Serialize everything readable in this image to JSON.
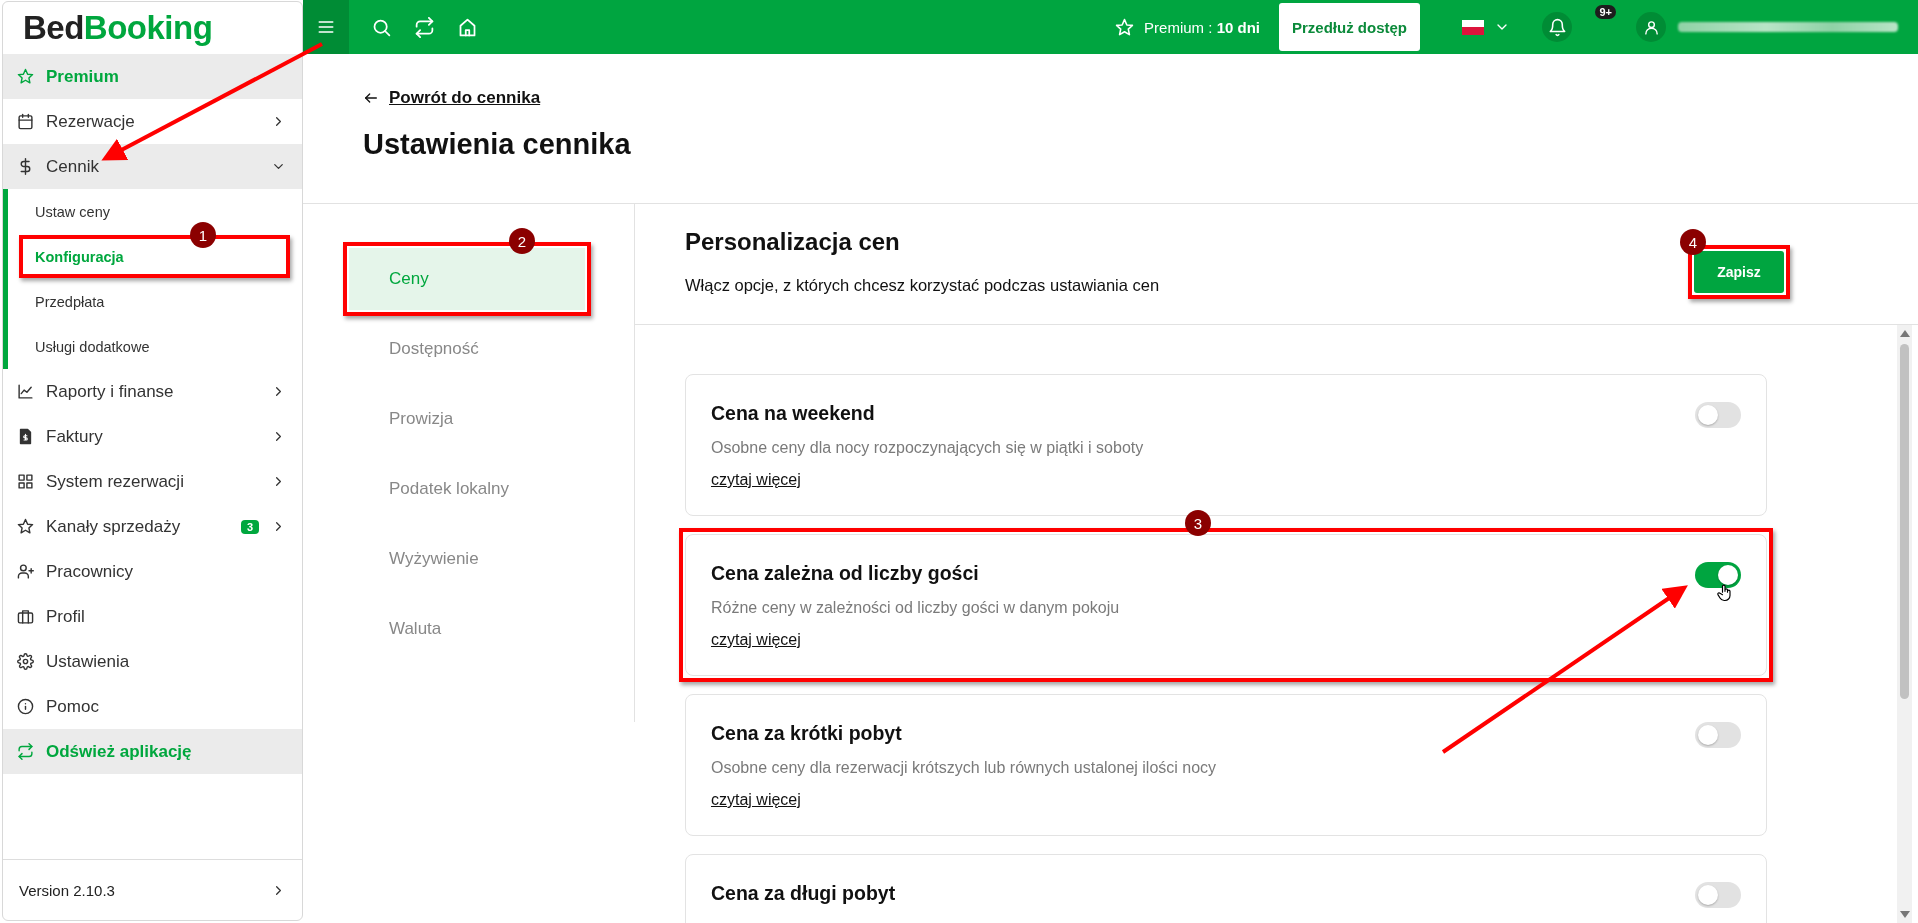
{
  "logo": {
    "part1": "Bed",
    "part2": "Booking"
  },
  "topbar": {
    "premium_label": "Premium :",
    "premium_days": "10 dni",
    "extend_button": "Przedłuż dostęp",
    "notification_badge": "9+"
  },
  "sidebar": {
    "items": [
      {
        "label": "Premium",
        "kind": "action"
      },
      {
        "label": "Rezerwacje",
        "kind": "link",
        "selected": false,
        "expanded": false
      },
      {
        "label": "Cennik",
        "kind": "link",
        "selected": true,
        "expanded": true,
        "children": [
          {
            "label": "Ustaw ceny",
            "selected": false
          },
          {
            "label": "Konfiguracja",
            "selected": true,
            "annotation": "1"
          },
          {
            "label": "Przedpłata",
            "selected": false
          },
          {
            "label": "Usługi dodatkowe",
            "selected": false
          }
        ]
      },
      {
        "label": "Raporty i finanse",
        "kind": "link",
        "selected": false,
        "expanded": false
      },
      {
        "label": "Faktury",
        "kind": "link",
        "selected": false,
        "expanded": false
      },
      {
        "label": "System rezerwacji",
        "kind": "link",
        "selected": false,
        "expanded": false
      },
      {
        "label": "Kanały sprzedaży",
        "kind": "link",
        "selected": false,
        "expanded": false,
        "badge": "3"
      },
      {
        "label": "Pracownicy",
        "kind": "link",
        "selected": false
      },
      {
        "label": "Profil",
        "kind": "link",
        "selected": false
      },
      {
        "label": "Ustawienia",
        "kind": "link",
        "selected": false
      },
      {
        "label": "Pomoc",
        "kind": "link",
        "selected": false
      },
      {
        "label": "Odśwież aplikację",
        "kind": "action"
      }
    ],
    "version": "Version 2.10.3"
  },
  "page": {
    "back_link": "Powrót do cennika",
    "title": "Ustawienia cennika"
  },
  "tabs": [
    {
      "label": "Ceny",
      "selected": true,
      "annotation": "2"
    },
    {
      "label": "Dostępność",
      "selected": false
    },
    {
      "label": "Prowizja",
      "selected": false
    },
    {
      "label": "Podatek lokalny",
      "selected": false
    },
    {
      "label": "Wyżywienie",
      "selected": false
    },
    {
      "label": "Waluta",
      "selected": false
    }
  ],
  "panel": {
    "title": "Personalizacja cen",
    "subtitle": "Włącz opcje, z których chcesz korzystać podczas ustawiania cen",
    "save_button": {
      "label": "Zapisz",
      "annotation": "4"
    }
  },
  "options": [
    {
      "title": "Cena na weekend",
      "description": "Osobne ceny dla nocy rozpoczynających się w piątki i soboty",
      "link": "czytaj więcej",
      "on": false,
      "hovered": false
    },
    {
      "title": "Cena zależna od liczby gości",
      "description": "Różne ceny w zależności od liczby gości w danym pokoju",
      "link": "czytaj więcej",
      "on": true,
      "hovered": true,
      "annotation": "3"
    },
    {
      "title": "Cena za krótki pobyt",
      "description": "Osobne ceny dla rezerwacji krótszych lub równych ustalonej ilości nocy",
      "link": "czytaj więcej",
      "on": false,
      "hovered": false
    },
    {
      "title": "Cena za długi pobyt",
      "on": false,
      "hovered": false
    }
  ]
}
